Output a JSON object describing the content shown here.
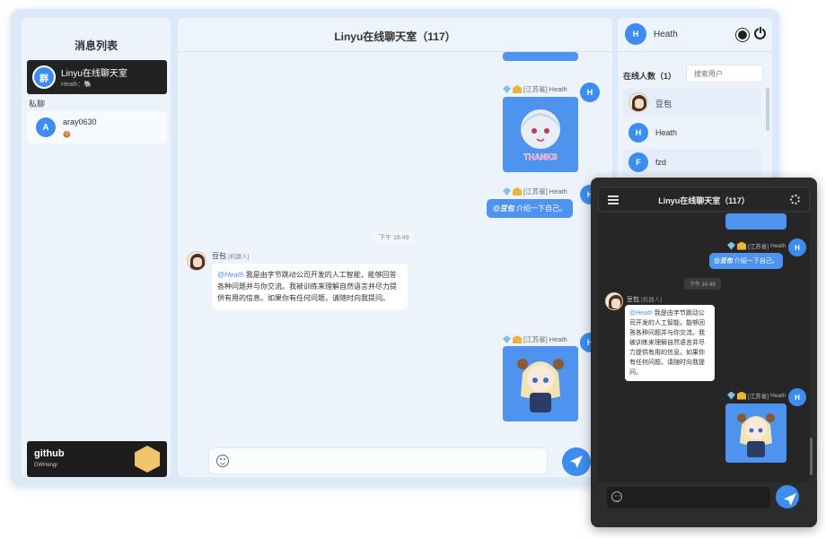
{
  "colors": {
    "accent": "#3d8df0",
    "bubble_blue": "#4e93ee",
    "dark_bg": "#2c2c2c"
  },
  "left": {
    "title": "消息列表",
    "group_chat": {
      "avatar": "群",
      "name": "Linyu在线聊天室",
      "last": "Heath：🐘"
    },
    "private_label": "私聊",
    "private_chats": [
      {
        "avatar": "A",
        "name": "aray0630",
        "last": "🍪"
      }
    ],
    "github": {
      "title": "github",
      "user": "DWHengr"
    }
  },
  "chat": {
    "title": "Linyu在线聊天室（117）",
    "sender_avatar": "H",
    "sender_region": "[江苏省]",
    "sender_name": "Heath",
    "msg1_img_text": "THANKS",
    "mention_msg": {
      "at": "@豆包",
      "text": " 介绍一下自己。"
    },
    "timestamp": "下午 16:49",
    "bot": {
      "name": "豆包",
      "tag": "[机器人]",
      "at": "@Heath",
      "reply": " 我是由字节跳动公司开发的人工智能，能够回答各种问题并与你交流。我被训练来理解自然语言并尽力提供有用的信息。如果你有任何问题，请随时向我提问。"
    },
    "input_placeholder": ""
  },
  "right": {
    "me": {
      "avatar": "H",
      "name": "Heath"
    },
    "online_label": "在线人数（1）",
    "search_placeholder": "搜索用户",
    "users": [
      {
        "avatar": "",
        "name": "豆包"
      },
      {
        "avatar": "H",
        "name": "Heath"
      },
      {
        "avatar": "F",
        "name": "fzd"
      }
    ]
  },
  "mobile": {
    "title": "Linyu在线聊天室（117）",
    "region": "[江苏省]",
    "name": "Heath",
    "mention_at": "@豆包",
    "mention_text": " 介绍一下自己。",
    "timestamp": "下午 16:49",
    "bot_name": "豆包",
    "bot_tag": "[机器人]",
    "bot_at": "@Heath",
    "bot_reply": " 我是由字节跳动公司开发的人工智能，能够回答各种问题并与你交流。我被训练来理解自然语言并尽力提供有用的信息。如果你有任何问题，请随时向我提问。"
  }
}
